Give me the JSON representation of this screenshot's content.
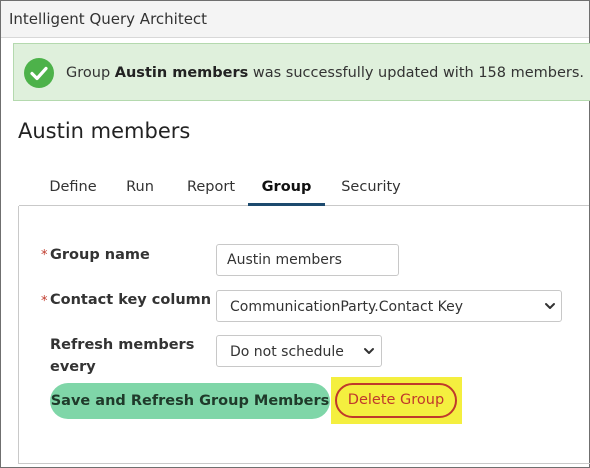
{
  "app": {
    "title": "Intelligent Query Architect"
  },
  "alert": {
    "prefix": "Group ",
    "group_name": "Austin members",
    "suffix": " was successfully updated with 158 members.",
    "icon": "check-circle-icon",
    "color": "#4db24a"
  },
  "page": {
    "title": "Austin members"
  },
  "tabs": [
    {
      "label": "Define",
      "active": false
    },
    {
      "label": "Run",
      "active": false
    },
    {
      "label": "Report",
      "active": false
    },
    {
      "label": "Group",
      "active": true
    },
    {
      "label": "Security",
      "active": false
    }
  ],
  "form": {
    "group_name": {
      "required_mark": "*",
      "label": "Group name",
      "value": "Austin members"
    },
    "contact_key": {
      "required_mark": "*",
      "label": "Contact key column",
      "value": "CommunicationParty.Contact Key"
    },
    "refresh": {
      "label_line1": "Refresh members",
      "label_line2": "every",
      "value": "Do not schedule"
    }
  },
  "buttons": {
    "save_refresh": "Save and Refresh Group Members",
    "delete_group": "Delete Group"
  },
  "colors": {
    "accent_tab": "#1d4a6e",
    "save_button": "#7fd6a8",
    "delete_button": "#c0392b",
    "highlight": "#f4ef3f",
    "alert_bg": "#dff0dc"
  }
}
